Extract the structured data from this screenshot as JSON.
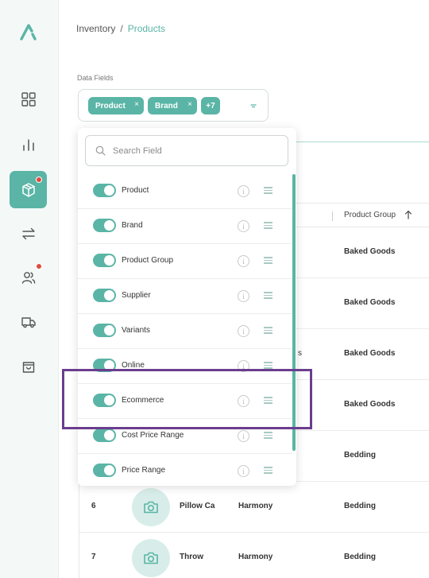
{
  "breadcrumb": {
    "parent": "Inventory",
    "separator": "/",
    "current": "Products"
  },
  "data_fields": {
    "label": "Data Fields",
    "chips": [
      {
        "label": "Product"
      },
      {
        "label": "Brand"
      }
    ],
    "more_label": "+7",
    "search_placeholder": "Search Field",
    "fields": [
      {
        "label": "Product",
        "enabled": true
      },
      {
        "label": "Brand",
        "enabled": true
      },
      {
        "label": "Product Group",
        "enabled": true
      },
      {
        "label": "Supplier",
        "enabled": true
      },
      {
        "label": "Variants",
        "enabled": true
      },
      {
        "label": "Online",
        "enabled": true
      },
      {
        "label": "Ecommerce",
        "enabled": true
      },
      {
        "label": "Cost Price Range",
        "enabled": true
      },
      {
        "label": "Price Range",
        "enabled": true
      }
    ],
    "info_glyph": "i",
    "chip_remove_glyph": "×"
  },
  "table": {
    "column_header": "Product Group",
    "partial_text": "s",
    "rows": [
      {
        "num": "",
        "name": "",
        "brand": "",
        "group": "Baked Goods"
      },
      {
        "num": "",
        "name": "",
        "brand": "",
        "group": "Baked Goods"
      },
      {
        "num": "",
        "name": "",
        "brand": "",
        "group": "Baked Goods"
      },
      {
        "num": "",
        "name": "",
        "brand": "",
        "group": "Baked Goods"
      },
      {
        "num": "",
        "name": "",
        "brand": "",
        "group": "Bedding"
      },
      {
        "num": "6",
        "name": "Pillow Ca",
        "brand": "Harmony",
        "group": "Bedding"
      },
      {
        "num": "7",
        "name": "Throw",
        "brand": "Harmony",
        "group": "Bedding"
      }
    ]
  },
  "sidebar": {
    "items": [
      {
        "icon": "dashboard-icon"
      },
      {
        "icon": "chart-icon"
      },
      {
        "icon": "box-icon",
        "active": true,
        "badge": true
      },
      {
        "icon": "transfer-icon"
      },
      {
        "icon": "users-icon",
        "badge": true
      },
      {
        "icon": "truck-icon"
      },
      {
        "icon": "shopping-bag-icon"
      }
    ]
  },
  "colors": {
    "accent": "#5ab5a6",
    "badge": "#e04a3c",
    "highlight": "#6a3d8e"
  }
}
